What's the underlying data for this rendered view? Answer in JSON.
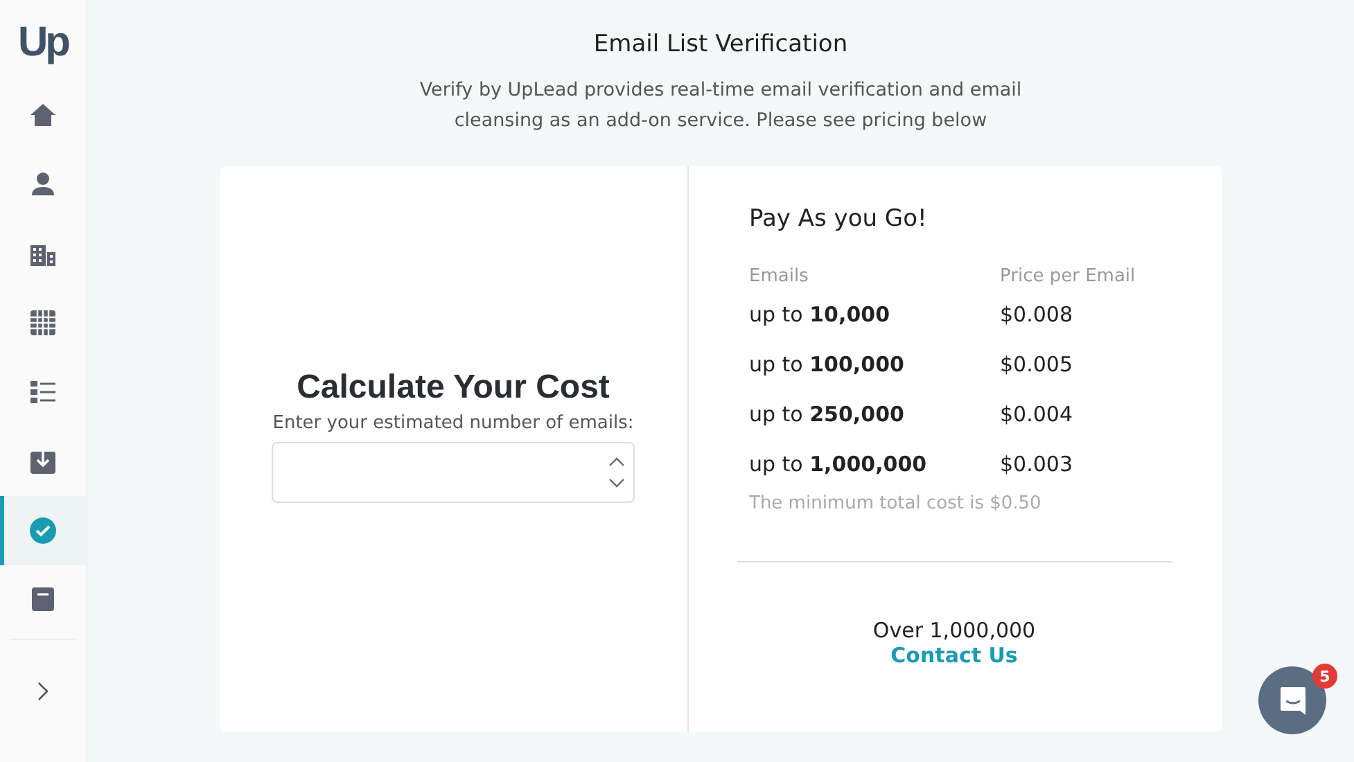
{
  "logo": "Up",
  "sidebar": {
    "items": [
      {
        "kind": "home",
        "selected": false
      },
      {
        "kind": "person",
        "selected": false
      },
      {
        "kind": "building",
        "selected": false
      },
      {
        "kind": "table",
        "selected": false
      },
      {
        "kind": "list",
        "selected": false
      },
      {
        "kind": "download",
        "selected": false
      },
      {
        "kind": "check",
        "selected": true
      },
      {
        "kind": "book",
        "selected": false
      }
    ]
  },
  "header": {
    "title": "Email List Verification",
    "description": "Verify by UpLead provides real-time email verification and email cleansing as an add-on service. Please see pricing below"
  },
  "calculator": {
    "title": "Calculate Your Cost",
    "label": "Enter your estimated number of emails:"
  },
  "pricing": {
    "title": "Pay As you Go!",
    "columns": [
      "Emails",
      "Price per Email"
    ],
    "rows": [
      {
        "emails": "up to **10,000**",
        "price": "$0.008"
      },
      {
        "emails": "up to **100,000**",
        "price": "$0.005"
      },
      {
        "emails": "up to **250,000**",
        "price": "$0.004"
      },
      {
        "emails": "up to **1,000,000**",
        "price": "$0.003"
      }
    ],
    "note": "The minimum total cost is $0.50",
    "over": "Over 1,000,000",
    "contact": "Contact Us"
  },
  "chat": {
    "badge": "5"
  }
}
